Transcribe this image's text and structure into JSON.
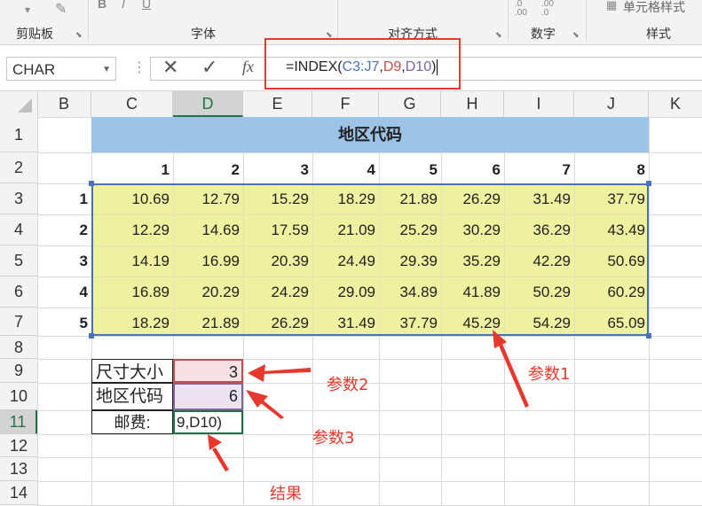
{
  "ribbon": {
    "groups": [
      "剪贴板",
      "字体",
      "对齐方式",
      "数字",
      "样式"
    ],
    "cell_style_btn": "单元格样式",
    "font_buttons": [
      "B",
      "I",
      "U"
    ]
  },
  "formula_bar": {
    "name_box": "CHAR",
    "cancel": "✕",
    "enter": "✓",
    "fx": "fx",
    "formula_parts": [
      "=INDEX(",
      "C3:J7",
      ",",
      "D9",
      ",",
      "D10",
      ")"
    ],
    "part_colors": [
      "#222222",
      "#4a72b8",
      "#222222",
      "#c0504d",
      "#222222",
      "#8064a2",
      "#222222"
    ]
  },
  "columns": [
    "B",
    "C",
    "D",
    "E",
    "F",
    "G",
    "H",
    "I",
    "J",
    "K"
  ],
  "rows": [
    "1",
    "2",
    "3",
    "4",
    "5",
    "6",
    "7",
    "8",
    "9",
    "10",
    "11",
    "12",
    "13",
    "14"
  ],
  "sheet": {
    "title": "地区代码",
    "col_codes": [
      "1",
      "2",
      "3",
      "4",
      "5",
      "6",
      "7",
      "8"
    ],
    "row_codes": [
      "1",
      "2",
      "3",
      "4",
      "5"
    ],
    "values": [
      [
        "10.69",
        "12.79",
        "15.29",
        "18.29",
        "21.89",
        "26.29",
        "31.49",
        "37.79"
      ],
      [
        "12.29",
        "14.69",
        "17.59",
        "21.09",
        "25.29",
        "30.29",
        "36.29",
        "43.49"
      ],
      [
        "14.19",
        "16.99",
        "20.39",
        "24.49",
        "29.39",
        "35.29",
        "42.29",
        "50.69"
      ],
      [
        "16.89",
        "20.29",
        "24.29",
        "29.09",
        "34.89",
        "41.89",
        "50.29",
        "60.29"
      ],
      [
        "18.29",
        "21.89",
        "26.29",
        "31.49",
        "37.79",
        "45.29",
        "54.29",
        "65.09"
      ]
    ],
    "size_label": "尺寸大小",
    "size_value": "3",
    "region_label": "地区代码",
    "region_value": "6",
    "postage_label": "邮费:",
    "postage_edit": "9,D10)"
  },
  "annotations": {
    "param1": "参数1",
    "param2": "参数2",
    "param3": "参数3",
    "result": "结果"
  },
  "colors": {
    "header_fill": "#9dc3e6",
    "data_fill": "#eef19f",
    "accent_red": "#e8372c",
    "excel_green": "#217346"
  }
}
